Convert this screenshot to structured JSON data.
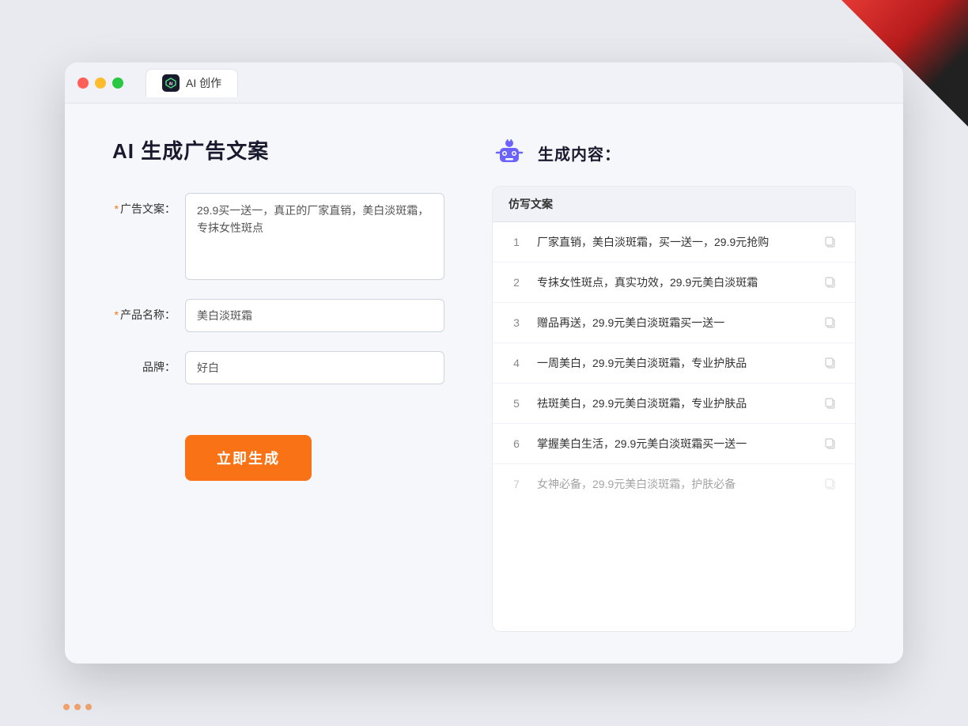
{
  "window": {
    "tab_label": "AI 创作",
    "tab_icon": "AI"
  },
  "left_panel": {
    "page_title": "AI 生成广告文案",
    "form": {
      "ad_copy_label": "广告文案：",
      "ad_copy_required": "*",
      "ad_copy_value": "29.9买一送一，真正的厂家直销，美白淡斑霜，专抹女性斑点",
      "product_name_label": "产品名称：",
      "product_name_required": "*",
      "product_name_value": "美白淡斑霜",
      "brand_label": "品牌：",
      "brand_value": "好白"
    },
    "generate_button": "立即生成"
  },
  "right_panel": {
    "title": "生成内容：",
    "table_header": "仿写文案",
    "results": [
      {
        "num": "1",
        "text": "厂家直销，美白淡斑霜，买一送一，29.9元抢购",
        "faded": false
      },
      {
        "num": "2",
        "text": "专抹女性斑点，真实功效，29.9元美白淡斑霜",
        "faded": false
      },
      {
        "num": "3",
        "text": "赠品再送，29.9元美白淡斑霜买一送一",
        "faded": false
      },
      {
        "num": "4",
        "text": "一周美白，29.9元美白淡斑霜，专业护肤品",
        "faded": false
      },
      {
        "num": "5",
        "text": "祛斑美白，29.9元美白淡斑霜，专业护肤品",
        "faded": false
      },
      {
        "num": "6",
        "text": "掌握美白生活，29.9元美白淡斑霜买一送一",
        "faded": false
      },
      {
        "num": "7",
        "text": "女神必备，29.9元美白淡斑霜，护肤必备",
        "faded": true
      }
    ]
  }
}
